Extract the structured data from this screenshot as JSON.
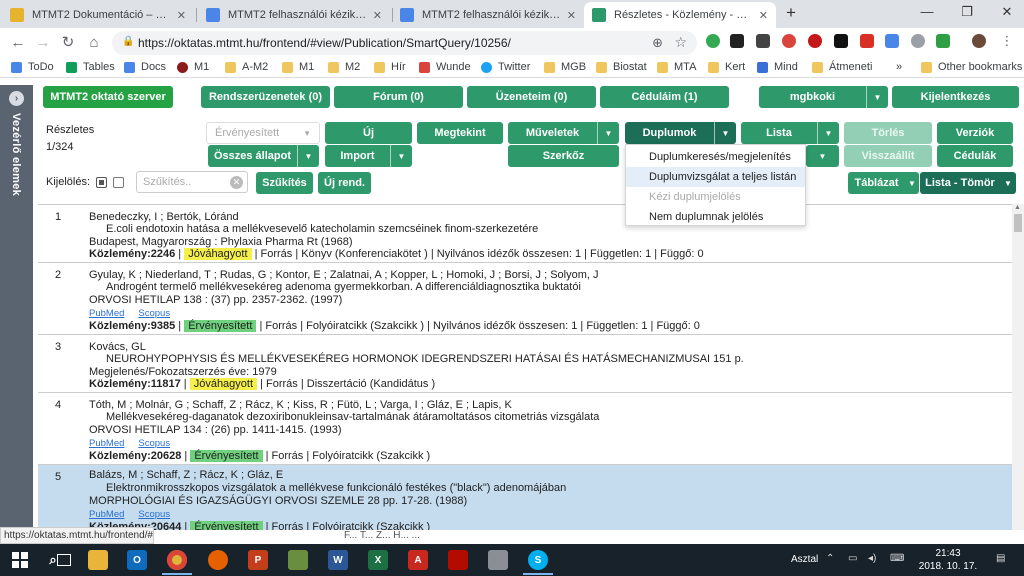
{
  "browser": {
    "tabs": [
      {
        "title": "MTMT2 Dokumentáció – Google",
        "favicon_color": "#e5b32d",
        "active": false
      },
      {
        "title": "MTMT2 felhasználói kézikönyv Sz",
        "favicon_color": "#4a86e8",
        "active": false
      },
      {
        "title": "MTMT2 felhasználói kézikönyv Sz",
        "favicon_color": "#4a86e8",
        "active": false
      },
      {
        "title": "Részletes - Közlemény - Mtmt2",
        "favicon_color": "#2e9a6c",
        "active": true
      }
    ],
    "new_tab_glyph": "+",
    "url": "https://oktatas.mtmt.hu/frontend/#view/Publication/SmartQuery/10256/",
    "bookmarks": [
      "ToDo",
      "Tables",
      "Docs",
      "M1",
      "A-M2",
      "M1",
      "M2",
      "Hír",
      "Wunde",
      "Twitter",
      "MGB",
      "Biostat",
      "MTA",
      "Kert",
      "Mind",
      "Átmeneti",
      "»",
      "Other bookmarks"
    ]
  },
  "app": {
    "sidepanel_label": "Vezérlő elemek",
    "topbar": {
      "server": "MTMT2 oktató szerver",
      "notifications": "Rendszerüzenetek (0)",
      "forum": "Fórum (0)",
      "messages": "Üzeneteim (0)",
      "targets": "Céduláim (1)",
      "user": "mgbkoki",
      "logout": "Kijelentkezés"
    },
    "view": {
      "title": "Részletes",
      "counter": "1/324",
      "status_select": "Érvényesített",
      "new": "Új",
      "review": "Megtekint",
      "operations": "Műveletek",
      "duplicates": "Duplumok",
      "list": "Lista",
      "delete": "Törlés",
      "versions": "Verziók",
      "all_states": "Összes állapot",
      "import": "Import",
      "editor": "Szerkőz",
      "restore": "Visszaállít",
      "ticket": "Cédulák",
      "table_view": "Táblázat",
      "list_compact": "Lista - Tömör",
      "selection_label": "Kijelölés:",
      "search_placeholder": "Szűkítés..",
      "search_btn": "Szűkítés",
      "new_query": "Új rend."
    },
    "dup_menu": [
      {
        "label": "Duplumkeresés/megjelenítés",
        "state": "normal"
      },
      {
        "label": "Duplumvizsgálat a teljes listán",
        "state": "highlight"
      },
      {
        "label": "Kézi duplumjelölés",
        "state": "disabled"
      },
      {
        "label": "Nem duplumnak jelölés",
        "state": "normal"
      }
    ],
    "records": [
      {
        "num": "1",
        "authors": "Benedeczky, I ; Bertók, Lóránd",
        "title": "E.coli endotoxin hatása a mellékvesevelő katecholamin szemcséinek finom-szerkezetére",
        "source": "Budapest, Magyarország : Phylaxia Pharma Rt (1968)",
        "links": [],
        "id_label": "Közlemény:2246",
        "status": "Jóváhagyott",
        "status_color": "yellow",
        "rest": " | Forrás | Könyv (Konferenciakötet ) | Nyilvános idézők összesen: 1 | Független: 1 | Függő: 0"
      },
      {
        "num": "2",
        "authors": "Gyulay, K ; Niederland, T ; Rudas, G ; Kontor, E ; Zalatnai, A ; Kopper, L ; Homoki, J ; Borsi, J ; Solyom, J",
        "title": "Androgént termelő mellékvesekéreg adenoma gyermekkorban. A differenciáldiagnosztika buktatói",
        "source": "ORVOSI HETILAP 138 : (37) pp. 2357-2362. (1997)",
        "links": [
          "PubMed",
          "Scopus"
        ],
        "id_label": "Közlemény:9385",
        "status": "Érvényesített",
        "status_color": "green",
        "rest": " | Forrás | Folyóiratcikk (Szakcikk ) | Nyilvános idézők összesen: 1 | Független: 1 | Függő: 0"
      },
      {
        "num": "3",
        "authors": "Kovács, GL",
        "title": "NEUROHYPOPHYSIS ÉS MELLÉKVESEKÉREG HORMONOK IDEGRENDSZERI HATÁSAI ÉS HATÁSMECHANIZMUSAI 151 p.",
        "source": "Megjelenés/Fokozatszerzés éve: 1979",
        "links": [],
        "id_label": "Közlemény:11817",
        "status": "Jóváhagyott",
        "status_color": "yellow",
        "rest": " | Forrás | Disszertáció (Kandidátus )"
      },
      {
        "num": "4",
        "authors": "Tóth, M ; Molnár, G ; Schaff, Z ; Rácz, K ; Kiss, R ; Fütö, L ; Varga, I ; Gláz, E ; Lapis, K",
        "title": "Mellékvesekéreg-daganatok dezoxiribonukleinsav-tartalmának átáramoltatásos citometriás vizsgálata",
        "source": "ORVOSI HETILAP 134 : (26) pp. 1411-1415. (1993)",
        "links": [
          "PubMed",
          "Scopus"
        ],
        "id_label": "Közlemény:20628",
        "status": "Érvényesített",
        "status_color": "green",
        "rest": " | Forrás | Folyóiratcikk (Szakcikk )"
      },
      {
        "num": "5",
        "authors": "Balázs, M ; Schaff, Z ; Rácz, K ; Gláz, E",
        "title": "Elektronmikrosszkopos vizsgálatok a mellékvese funkcionáló festékes (\"black\") adenomájában",
        "source": "MORPHOLÓGIAI ÉS IGAZSÁGÜGYI ORVOSI SZEMLE 28 pp. 17-28. (1988)",
        "links": [
          "PubMed",
          "Scopus"
        ],
        "id_label": "Közlemény:20644",
        "status": "Érvényesített",
        "status_color": "green",
        "rest": " | Forrás | Folyóiratcikk (Szakcikk )"
      }
    ],
    "status_url": "https://oktatas.mtmt.hu/frontend/#",
    "partial_text": "F... T... Z... H... ..."
  },
  "taskbar": {
    "desktop_label": "Asztal",
    "time": "21:43",
    "date": "2018. 10. 17."
  },
  "colors": {
    "green_button": "#2e9a6c",
    "dark_green_button": "#1c6e57",
    "selected_row": "#c5dcef",
    "approved_badge": "#f5ef4a",
    "validated_badge": "#6fd17d"
  }
}
